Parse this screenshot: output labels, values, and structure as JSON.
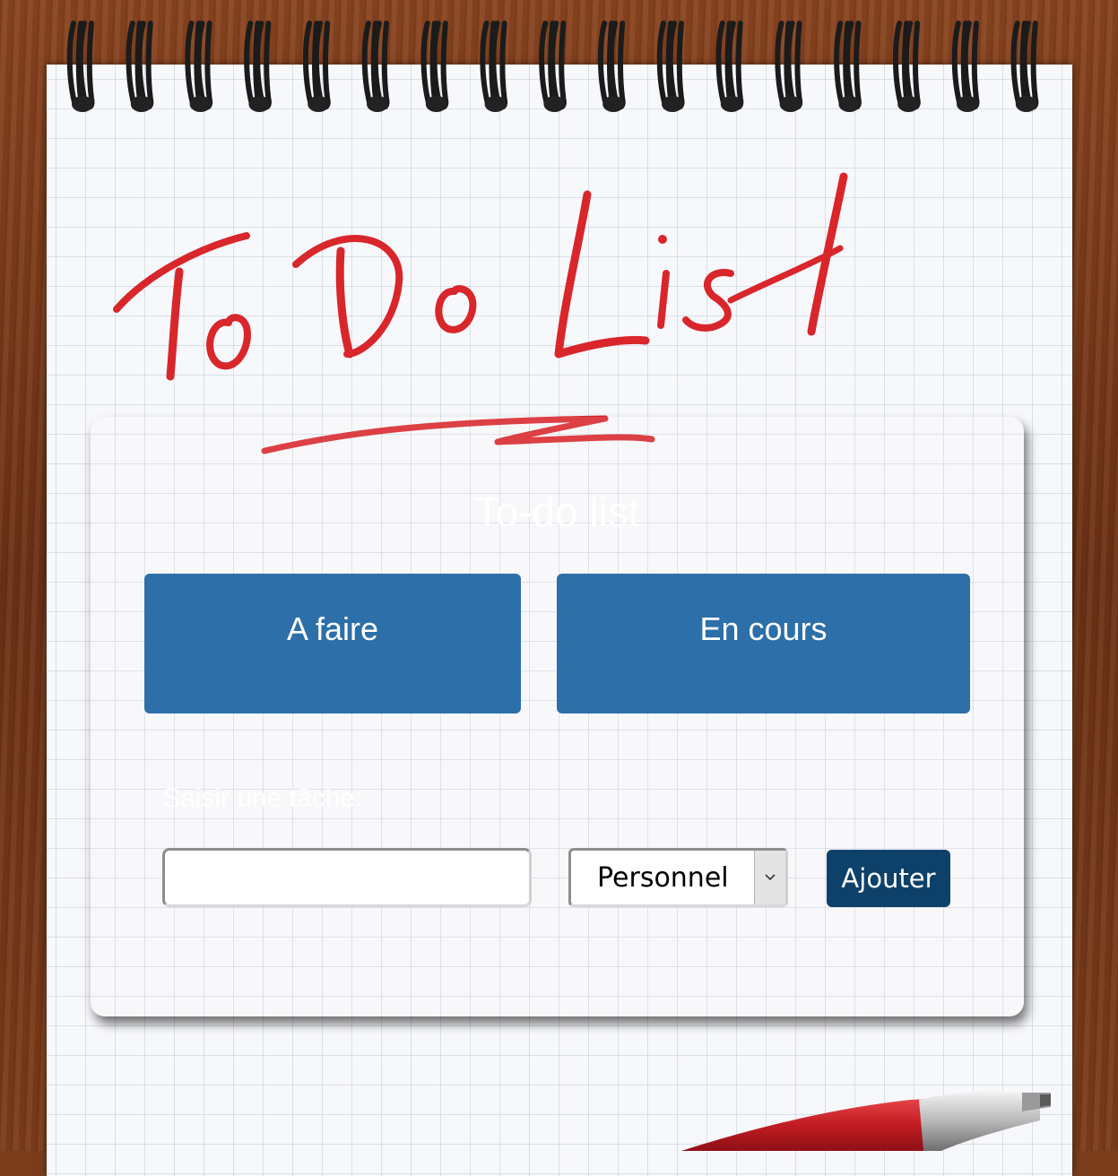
{
  "header": {
    "handwritten_title": "To Do List"
  },
  "card": {
    "title": "To-do list",
    "columns": [
      {
        "label": "A faire"
      },
      {
        "label": "En cours"
      }
    ],
    "form": {
      "label": "Saisir une tâche:",
      "input_value": "",
      "category_selected": "Personnel",
      "add_label": "Ajouter"
    }
  },
  "colors": {
    "column_button": "#2d6fa8",
    "add_button": "#0e4169",
    "handwriting": "#d8262b"
  },
  "icons": [
    "chevron-down-icon",
    "spiral-binding",
    "red-pen"
  ]
}
